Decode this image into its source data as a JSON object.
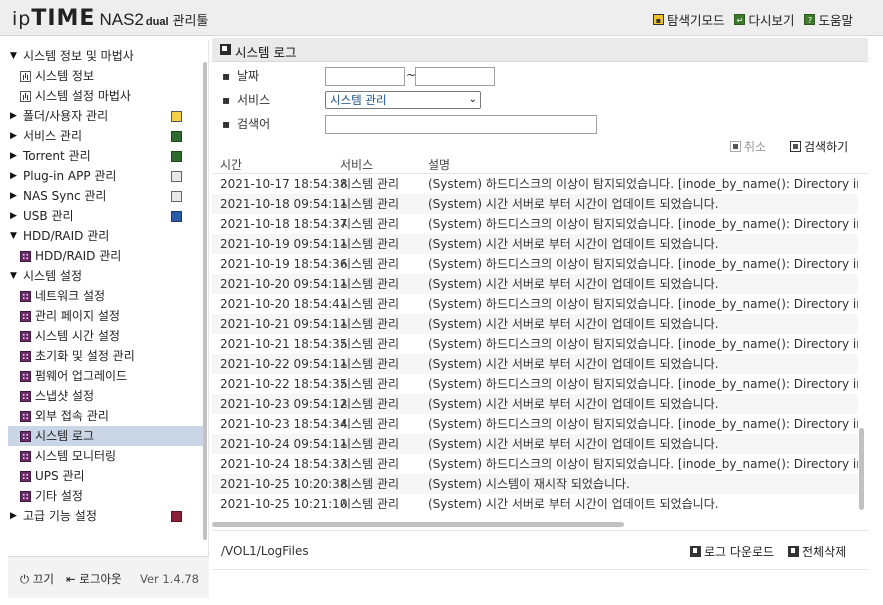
{
  "header": {
    "logo_ip": "ip",
    "logo_time": "TIME",
    "logo_model": "NAS2",
    "logo_dual": "dual",
    "logo_suffix": "관리툴",
    "links": [
      {
        "label": "탐색기모드",
        "icon": "folder-icon"
      },
      {
        "label": "다시보기",
        "icon": "refresh-icon"
      },
      {
        "label": "도움말",
        "icon": "help-icon"
      }
    ]
  },
  "sidebar": {
    "items": [
      {
        "label": "시스템 정보 및 마법사",
        "level": "top",
        "expanded": true
      },
      {
        "label": "시스템 정보",
        "level": "sub",
        "icon": "chart-icon"
      },
      {
        "label": "시스템 설정 마법사",
        "level": "sub",
        "icon": "chart-icon"
      },
      {
        "label": "폴더/사용자 관리",
        "level": "top",
        "expanded": false,
        "icon": "folder-user-icon"
      },
      {
        "label": "서비스 관리",
        "level": "top",
        "expanded": false,
        "icon": "service-icon"
      },
      {
        "label": "Torrent 관리",
        "level": "top",
        "expanded": false,
        "icon": "torrent-icon"
      },
      {
        "label": "Plug-in APP 관리",
        "level": "top",
        "expanded": false,
        "icon": "plugin-icon"
      },
      {
        "label": "NAS Sync 관리",
        "level": "top",
        "expanded": false,
        "icon": "sync-icon"
      },
      {
        "label": "USB 관리",
        "level": "top",
        "expanded": false,
        "icon": "usb-icon"
      },
      {
        "label": "HDD/RAID 관리",
        "level": "top",
        "expanded": true
      },
      {
        "label": "HDD/RAID 관리",
        "level": "sub",
        "icon": "disk-icon"
      },
      {
        "label": "시스템 설정",
        "level": "top",
        "expanded": true
      },
      {
        "label": "네트워크 설정",
        "level": "sub",
        "icon": "settings-icon"
      },
      {
        "label": "관리 페이지 설정",
        "level": "sub",
        "icon": "settings-icon"
      },
      {
        "label": "시스템 시간 설정",
        "level": "sub",
        "icon": "settings-icon"
      },
      {
        "label": "초기화 및 설정 관리",
        "level": "sub",
        "icon": "settings-icon"
      },
      {
        "label": "펌웨어 업그레이드",
        "level": "sub",
        "icon": "settings-icon"
      },
      {
        "label": "스냅샷 설정",
        "level": "sub",
        "icon": "settings-icon"
      },
      {
        "label": "외부 접속 관리",
        "level": "sub",
        "icon": "settings-icon"
      },
      {
        "label": "시스템 로그",
        "level": "sub",
        "icon": "settings-icon",
        "selected": true
      },
      {
        "label": "시스템 모니터링",
        "level": "sub",
        "icon": "settings-icon"
      },
      {
        "label": "UPS 관리",
        "level": "sub",
        "icon": "settings-icon"
      },
      {
        "label": "기타 설정",
        "level": "sub",
        "icon": "settings-icon"
      },
      {
        "label": "고급 기능 설정",
        "level": "top",
        "expanded": false,
        "icon": "advanced-icon"
      }
    ],
    "footer": {
      "power_label": "끄기",
      "logout_label": "로그아웃",
      "version": "Ver 1.4.78"
    }
  },
  "main": {
    "title": "시스템 로그",
    "filters": {
      "date_label": "날짜",
      "date_from": "",
      "date_sep": "~",
      "date_to": "",
      "service_label": "서비스",
      "service_selected": "시스템 관리",
      "search_label": "검색어",
      "search_value": ""
    },
    "actions": {
      "cancel_label": "취소",
      "search_label": "검색하기"
    },
    "columns": [
      "시간",
      "서비스",
      "설명"
    ],
    "rows": [
      [
        "2021-10-17 18:54:38",
        "시스템 관리",
        "(System) 하드디스크의 이상이 탐지되었습니다. [inode_by_name(): Directory index"
      ],
      [
        "2021-10-18 09:54:11",
        "시스템 관리",
        "(System) 시간 서버로 부터 시간이 업데이트 되었습니다."
      ],
      [
        "2021-10-18 18:54:37",
        "시스템 관리",
        "(System) 하드디스크의 이상이 탐지되었습니다. [inode_by_name(): Directory index"
      ],
      [
        "2021-10-19 09:54:11",
        "시스템 관리",
        "(System) 시간 서버로 부터 시간이 업데이트 되었습니다."
      ],
      [
        "2021-10-19 18:54:36",
        "시스템 관리",
        "(System) 하드디스크의 이상이 탐지되었습니다. [inode_by_name(): Directory index"
      ],
      [
        "2021-10-20 09:54:11",
        "시스템 관리",
        "(System) 시간 서버로 부터 시간이 업데이트 되었습니다."
      ],
      [
        "2021-10-20 18:54:41",
        "시스템 관리",
        "(System) 하드디스크의 이상이 탐지되었습니다. [inode_by_name(): Directory index"
      ],
      [
        "2021-10-21 09:54:11",
        "시스템 관리",
        "(System) 시간 서버로 부터 시간이 업데이트 되었습니다."
      ],
      [
        "2021-10-21 18:54:35",
        "시스템 관리",
        "(System) 하드디스크의 이상이 탐지되었습니다. [inode_by_name(): Directory index"
      ],
      [
        "2021-10-22 09:54:11",
        "시스템 관리",
        "(System) 시간 서버로 부터 시간이 업데이트 되었습니다."
      ],
      [
        "2021-10-22 18:54:35",
        "시스템 관리",
        "(System) 하드디스크의 이상이 탐지되었습니다. [inode_by_name(): Directory index"
      ],
      [
        "2021-10-23 09:54:12",
        "시스템 관리",
        "(System) 시간 서버로 부터 시간이 업데이트 되었습니다."
      ],
      [
        "2021-10-23 18:54:34",
        "시스템 관리",
        "(System) 하드디스크의 이상이 탐지되었습니다. [inode_by_name(): Directory index"
      ],
      [
        "2021-10-24 09:54:11",
        "시스템 관리",
        "(System) 시간 서버로 부터 시간이 업데이트 되었습니다."
      ],
      [
        "2021-10-24 18:54:33",
        "시스템 관리",
        "(System) 하드디스크의 이상이 탐지되었습니다. [inode_by_name(): Directory index"
      ],
      [
        "2021-10-25 10:20:38",
        "시스템 관리",
        "(System) 시스템이 재시작 되었습니다."
      ],
      [
        "2021-10-25 10:21:10",
        "시스템 관리",
        "(System) 시간 서버로 부터 시간이 업데이트 되었습니다."
      ]
    ],
    "footer": {
      "path": "/VOL1/LogFiles",
      "download_label": "로그 다운로드",
      "delete_all_label": "전체삭제"
    }
  }
}
